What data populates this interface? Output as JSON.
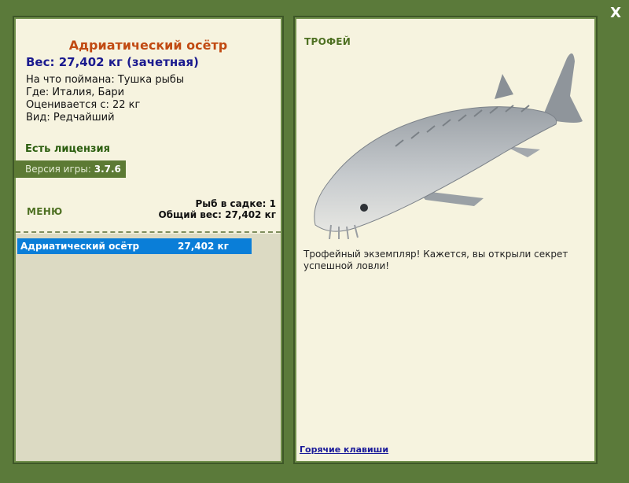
{
  "window": {
    "close_label": "X"
  },
  "fish": {
    "title": "Адриатический осётр",
    "weight_line": "Вес: 27,402 кг (зачетная)",
    "details": [
      "На что поймана: Тушка рыбы",
      "Где: Италия, Бари",
      "Оценивается с: 22 кг",
      "Вид: Редчайший"
    ]
  },
  "license": {
    "label": "Есть лицензия"
  },
  "version": {
    "label": "Версия игры:",
    "value": "3.7.6"
  },
  "menu": {
    "label": "МЕНЮ"
  },
  "stats": {
    "fish_in_keepnet": "Рыб в садке: 1",
    "total_weight": "Общий вес: 27,402 кг"
  },
  "catch_list": [
    {
      "name": "Адриатический осётр",
      "weight": "27,402 кг"
    }
  ],
  "trophy": {
    "title": "ТРОФЕЙ",
    "description": "Трофейный экземпляр! Кажется, вы открыли секрет успешной ловли!"
  },
  "hotkeys": {
    "label": "Горячие клавиши"
  },
  "colors": {
    "background": "#5b7a3a",
    "panel": "#f6f3df",
    "title_accent": "#c14a12",
    "selection": "#0a7ed8"
  }
}
